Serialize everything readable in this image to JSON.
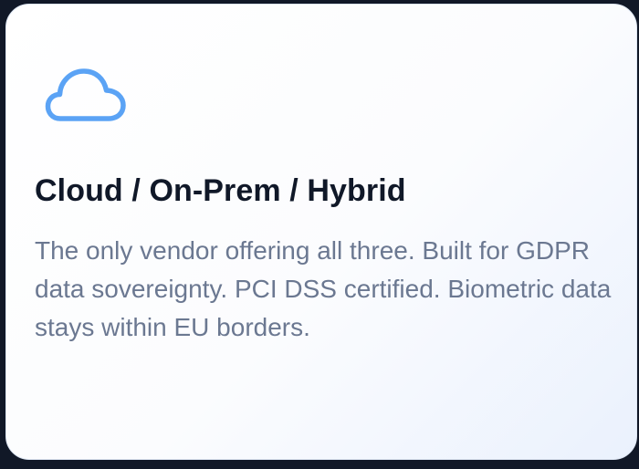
{
  "card": {
    "icon": "cloud-icon",
    "accent_color": "#5ba3f5",
    "title": "Cloud / On-Prem / Hybrid",
    "description": "The only vendor offering all three. Built for GDPR data sovereignty. PCI DSS certified. Biometric data stays within EU borders."
  }
}
